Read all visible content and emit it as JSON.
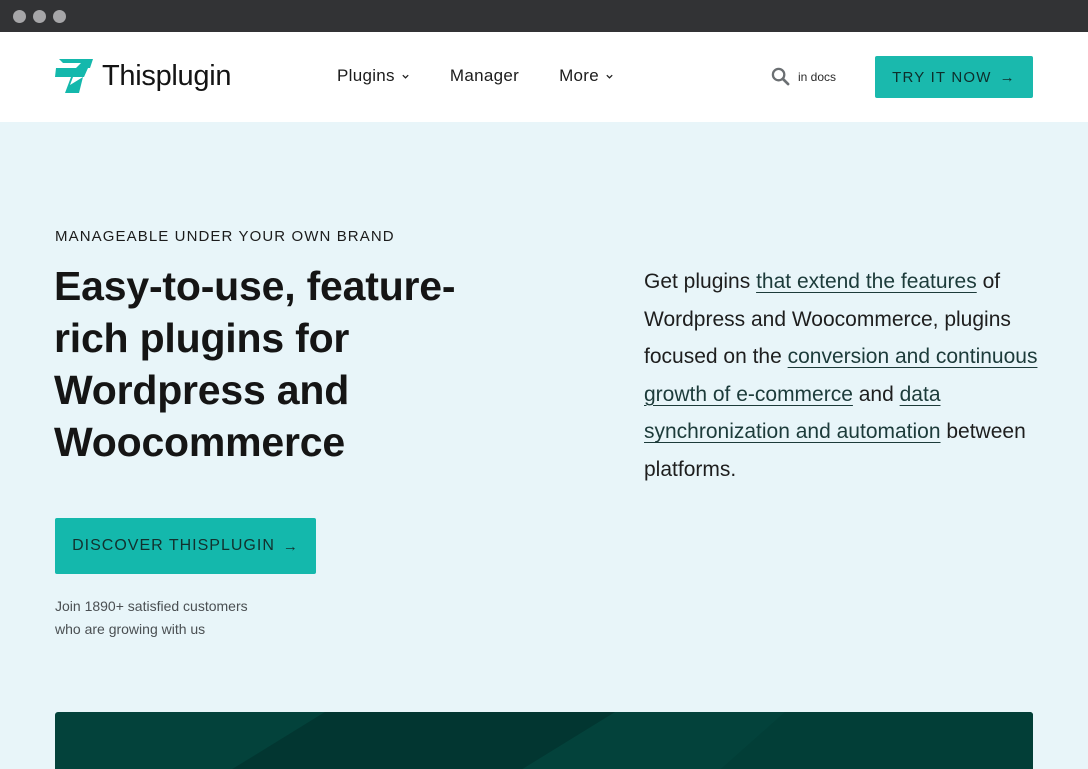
{
  "brand": {
    "name": "Thisplugin",
    "accent": "#1ab9ad",
    "logo_icon": "bolt-logo-icon"
  },
  "nav": {
    "items": [
      {
        "label": "Plugins",
        "has_dropdown": true
      },
      {
        "label": "Manager",
        "has_dropdown": false
      },
      {
        "label": "More",
        "has_dropdown": true
      }
    ],
    "search_icon": "search-icon",
    "search_label": "in docs",
    "cta_label": "TRY IT NOW",
    "cta_arrow": "→"
  },
  "hero": {
    "eyebrow": "MANAGEABLE UNDER YOUR OWN BRAND",
    "headline": "Easy-to-use, feature-rich plugins for Wordpress and Woocommerce",
    "cta_label": "DISCOVER THISPLUGIN",
    "cta_arrow": "→",
    "social_proof_line1": "Join 1890+ satisfied customers",
    "social_proof_line2": "who are growing with us",
    "lede": {
      "t1": "Get plugins ",
      "link1": "that extend the features",
      "t2": " of Wordpress and Woocommerce, plugins focused on the ",
      "link2": "conversion and continuous growth of e-commerce",
      "t3": " and ",
      "link3": "data synchronization and automation",
      "t4": " between platforms."
    },
    "background": "#e8f5f9",
    "showcase_color": "#03423b"
  }
}
